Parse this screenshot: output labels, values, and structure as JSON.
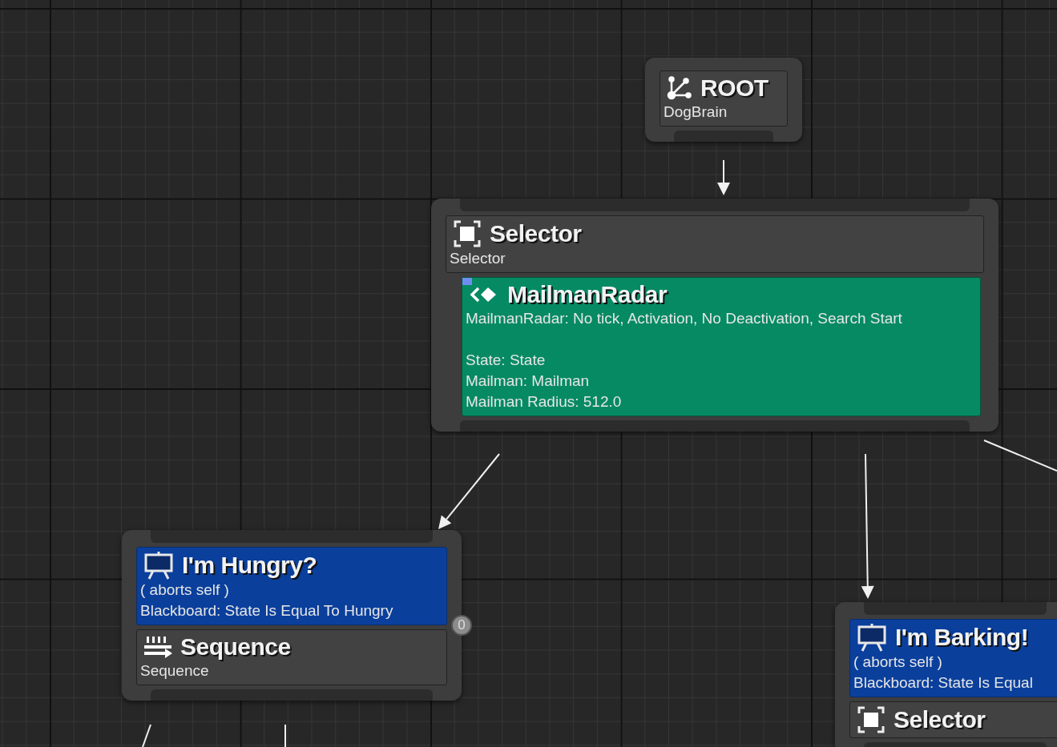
{
  "graph": {
    "nodes": [
      {
        "kind": "root",
        "title": "ROOT",
        "subtitle": "DogBrain"
      },
      {
        "kind": "composite",
        "composite": {
          "kind": "selector",
          "title": "Selector",
          "subtitle": "Selector"
        },
        "services": [
          {
            "title": "MailmanRadar",
            "summary": "MailmanRadar: No tick, Activation, No Deactivation, Search Start",
            "properties": [
              "State: State",
              "Mailman: Mailman",
              "Mailman Radius: 512.0"
            ]
          }
        ]
      },
      {
        "kind": "composite",
        "index": "0",
        "decorators": [
          {
            "title": "I'm Hungry?",
            "lines": [
              "( aborts self )",
              "Blackboard: State Is Equal To Hungry"
            ]
          }
        ],
        "composite": {
          "kind": "sequence",
          "title": "Sequence",
          "subtitle": "Sequence"
        }
      },
      {
        "kind": "composite",
        "decorators": [
          {
            "title": "I'm Barking!",
            "lines": [
              "( aborts self )",
              "Blackboard: State Is Equal"
            ]
          }
        ],
        "composite": {
          "kind": "selector",
          "title": "Selector"
        }
      }
    ]
  }
}
